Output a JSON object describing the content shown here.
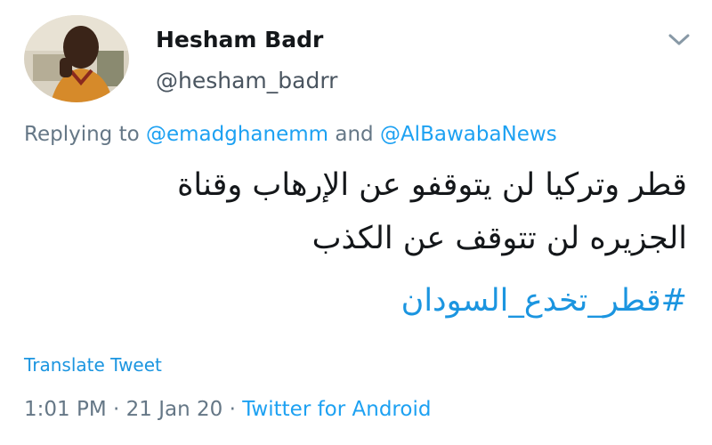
{
  "user": {
    "display_name": "Hesham Badr",
    "handle": "@hesham_badrr"
  },
  "reply": {
    "prefix": "Replying to",
    "mention1": "@emadghanemm",
    "joiner": "and",
    "mention2": "@AlBawabaNews"
  },
  "tweet": {
    "line1": "قطر وتركيا لن يتوقفو عن الإرهاب وقناة",
    "line2": "الجزيره لن تتوقف عن الكذب",
    "hashtag": "#قطر_تخدع_السودان"
  },
  "translate_label": "Translate Tweet",
  "meta": {
    "time": "1:01 PM",
    "separator": "·",
    "date": "21 Jan 20",
    "source": "Twitter for Android"
  },
  "icons": {
    "caret": "chevron-down-icon",
    "avatar": "avatar"
  },
  "colors": {
    "link": "#1da1f2",
    "text": "#14171a",
    "muted": "#657786"
  }
}
